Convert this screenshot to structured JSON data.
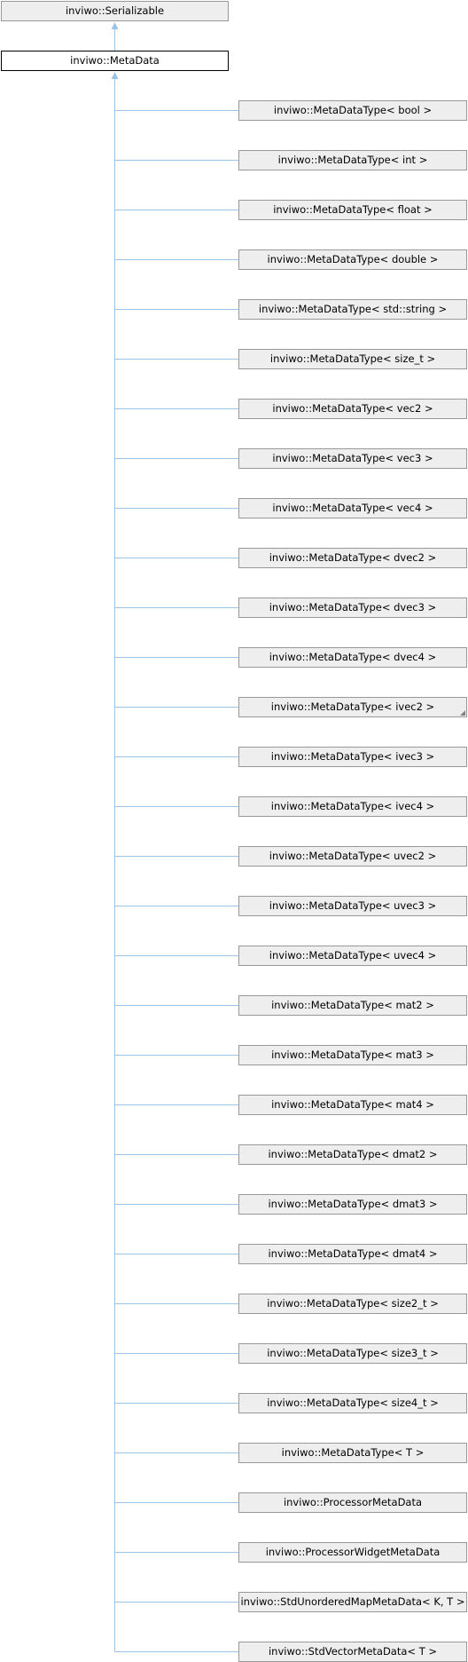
{
  "base": {
    "label": "inviwo::Serializable"
  },
  "current": {
    "label": "inviwo::MetaData"
  },
  "derived": [
    {
      "label": "inviwo::MetaDataType< bool >"
    },
    {
      "label": "inviwo::MetaDataType< int >"
    },
    {
      "label": "inviwo::MetaDataType< float >"
    },
    {
      "label": "inviwo::MetaDataType< double >"
    },
    {
      "label": "inviwo::MetaDataType< std::string >"
    },
    {
      "label": "inviwo::MetaDataType< size_t >"
    },
    {
      "label": "inviwo::MetaDataType< vec2 >"
    },
    {
      "label": "inviwo::MetaDataType< vec3 >"
    },
    {
      "label": "inviwo::MetaDataType< vec4 >"
    },
    {
      "label": "inviwo::MetaDataType< dvec2 >"
    },
    {
      "label": "inviwo::MetaDataType< dvec3 >"
    },
    {
      "label": "inviwo::MetaDataType< dvec4 >"
    },
    {
      "label": "inviwo::MetaDataType< ivec2 >",
      "truncated": true
    },
    {
      "label": "inviwo::MetaDataType< ivec3 >"
    },
    {
      "label": "inviwo::MetaDataType< ivec4 >"
    },
    {
      "label": "inviwo::MetaDataType< uvec2 >"
    },
    {
      "label": "inviwo::MetaDataType< uvec3 >"
    },
    {
      "label": "inviwo::MetaDataType< uvec4 >"
    },
    {
      "label": "inviwo::MetaDataType< mat2 >"
    },
    {
      "label": "inviwo::MetaDataType< mat3 >"
    },
    {
      "label": "inviwo::MetaDataType< mat4 >"
    },
    {
      "label": "inviwo::MetaDataType< dmat2 >"
    },
    {
      "label": "inviwo::MetaDataType< dmat3 >"
    },
    {
      "label": "inviwo::MetaDataType< dmat4 >"
    },
    {
      "label": "inviwo::MetaDataType< size2_t >"
    },
    {
      "label": "inviwo::MetaDataType< size3_t >"
    },
    {
      "label": "inviwo::MetaDataType< size4_t >"
    },
    {
      "label": "inviwo::MetaDataType< T >"
    },
    {
      "label": "inviwo::ProcessorMetaData"
    },
    {
      "label": "inviwo::ProcessorWidgetMetaData"
    },
    {
      "label": "inviwo::StdUnorderedMapMetaData< K, T >"
    },
    {
      "label": "inviwo::StdVectorMetaData< T >"
    }
  ],
  "colors": {
    "edge": "#9dc4e6",
    "node_fill": "#eeeeee",
    "node_border": "#999999",
    "current_border": "#000000"
  }
}
